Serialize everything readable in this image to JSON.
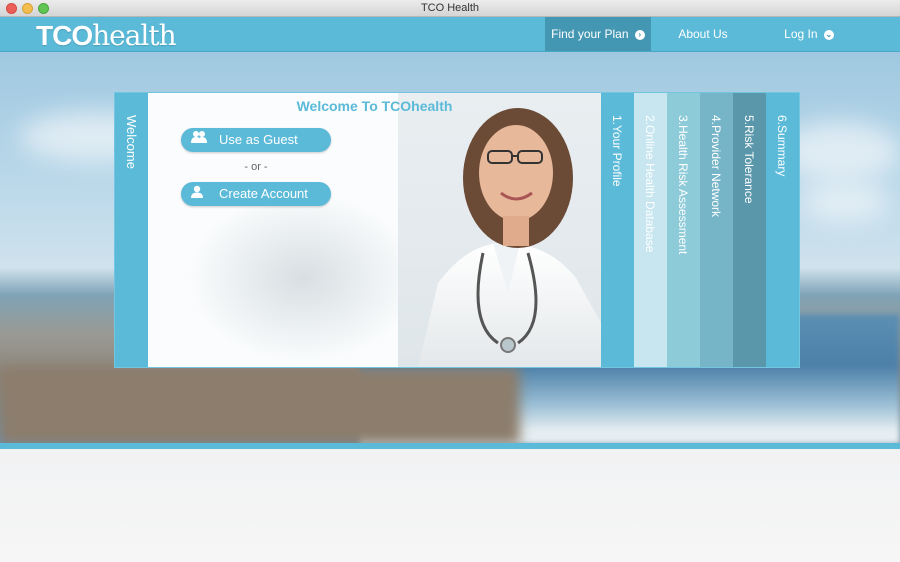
{
  "window": {
    "title": "TCO Health"
  },
  "header": {
    "logo_bold": "TCO",
    "logo_light": "health",
    "nav": [
      {
        "label": "Find your Plan",
        "icon": "chevron-right-circle-icon"
      },
      {
        "label": "About Us"
      },
      {
        "label": "Log In",
        "icon": "chevron-down-circle-icon"
      }
    ]
  },
  "panel": {
    "welcome_label": "Welcome",
    "title": "Welcome To TCOhealth",
    "guest_button": {
      "label": "Use as Guest",
      "icon": "users-icon"
    },
    "or_text": "- or -",
    "create_button": {
      "label": "Create Account",
      "icon": "user-icon"
    },
    "steps": [
      {
        "label": "1.Your Profile",
        "color": "#5bbad8"
      },
      {
        "label": "2.Online Health Database",
        "color": "#c7e6f0"
      },
      {
        "label": "3.Health Risk Assessment",
        "color": "#8ecbd9"
      },
      {
        "label": "4.Provider Network",
        "color": "#76b5c8"
      },
      {
        "label": "5.Risk Tolerance",
        "color": "#5a97ab"
      },
      {
        "label": "6.Summary",
        "color": "#5bbad8"
      }
    ]
  },
  "colors": {
    "accent": "#5bbad8",
    "nav_active": "#4497b3"
  }
}
